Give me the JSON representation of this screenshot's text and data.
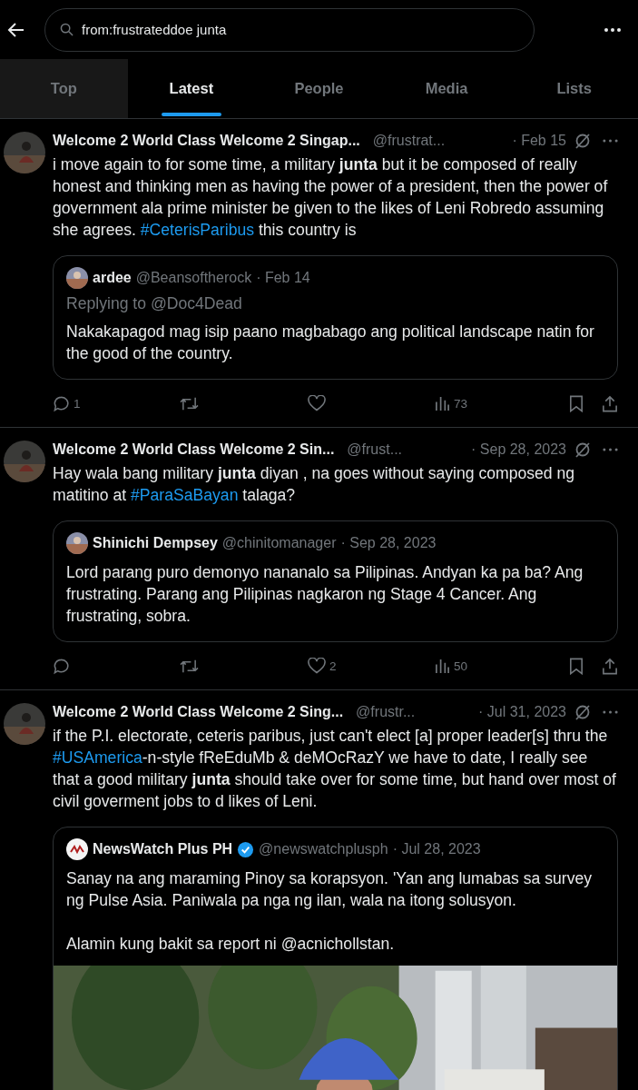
{
  "search": {
    "value": "from:frustrateddoe junta"
  },
  "tabs": [
    {
      "label": "Top",
      "selected": false,
      "hovered": true
    },
    {
      "label": "Latest",
      "selected": true,
      "hovered": false
    },
    {
      "label": "People",
      "selected": false,
      "hovered": false
    },
    {
      "label": "Media",
      "selected": false,
      "hovered": false
    },
    {
      "label": "Lists",
      "selected": false,
      "hovered": false
    }
  ],
  "tweets": [
    {
      "name": "Welcome 2 World Class Welcome 2 Singap...",
      "handle": "@frustrat...",
      "date": "· Feb 15",
      "text": [
        {
          "kind": "plain",
          "text": "i move again to for some time, a military "
        },
        {
          "kind": "bold",
          "text": "junta"
        },
        {
          "kind": "plain",
          "text": " but it be composed of really honest and thinking men as having the power of a president, then the power of government ala prime minister be given to the likes of Leni Robredo assuming she agrees. "
        },
        {
          "kind": "hashtag",
          "text": "#CeterisParibus"
        },
        {
          "kind": "plain",
          "text": "  this country is"
        }
      ],
      "quote": {
        "name": "ardee",
        "verified": false,
        "handle": "@Beansoftherock",
        "date": "· Feb 14",
        "replying_to": "Replying to @Doc4Dead",
        "text": "Nakakapagod mag isip paano magbabago ang political landscape natin for the good of the country."
      },
      "actions": {
        "replies": "1",
        "views": "73"
      }
    },
    {
      "name": "Welcome 2 World Class Welcome 2 Sin...",
      "handle": "@frust...",
      "date": "· Sep 28, 2023",
      "text": [
        {
          "kind": "plain",
          "text": "Hay wala bang military "
        },
        {
          "kind": "bold",
          "text": "junta"
        },
        {
          "kind": "plain",
          "text": " diyan , na goes without saying composed ng matitino at "
        },
        {
          "kind": "hashtag",
          "text": "#ParaSaBayan"
        },
        {
          "kind": "plain",
          "text": " talaga?"
        }
      ],
      "quote": {
        "name": "Shinichi Dempsey",
        "verified": false,
        "handle": "@chinitomanager",
        "date": "· Sep 28, 2023",
        "text": "Lord parang puro demonyo nananalo sa Pilipinas. Andyan ka pa ba? Ang frustrating. Parang ang Pilipinas nagkaron ng Stage 4 Cancer. Ang frustrating, sobra."
      },
      "actions": {
        "likes": "2",
        "views": "50"
      }
    },
    {
      "name": "Welcome 2 World Class Welcome 2 Sing...",
      "handle": "@frustr...",
      "date": "· Jul 31, 2023",
      "text": [
        {
          "kind": "plain",
          "text": "if the P.I. electorate, ceteris paribus, just can't elect [a] proper leader[s] thru the "
        },
        {
          "kind": "hashtag",
          "text": "#USAmerica"
        },
        {
          "kind": "plain",
          "text": "-n-style  fReEduMb & deMOcRazY we have to date, I really see that a good military "
        },
        {
          "kind": "bold",
          "text": "junta"
        },
        {
          "kind": "plain",
          "text": " should take over for some time, but hand over most of civil goverment jobs to d likes of Leni."
        }
      ],
      "quote": {
        "name": "NewsWatch Plus PH",
        "verified": true,
        "handle": "@newswatchplusph",
        "date": "· Jul 28, 2023",
        "text": "Sanay na ang maraming Pinoy sa korapsyon. 'Yan ang lumabas sa survey ng Pulse Asia. Paniwala pa nga ng ilan, wala na itong solusyon.\n\nAlamin kung bakit sa report ni @acnichollstan."
      }
    }
  ]
}
